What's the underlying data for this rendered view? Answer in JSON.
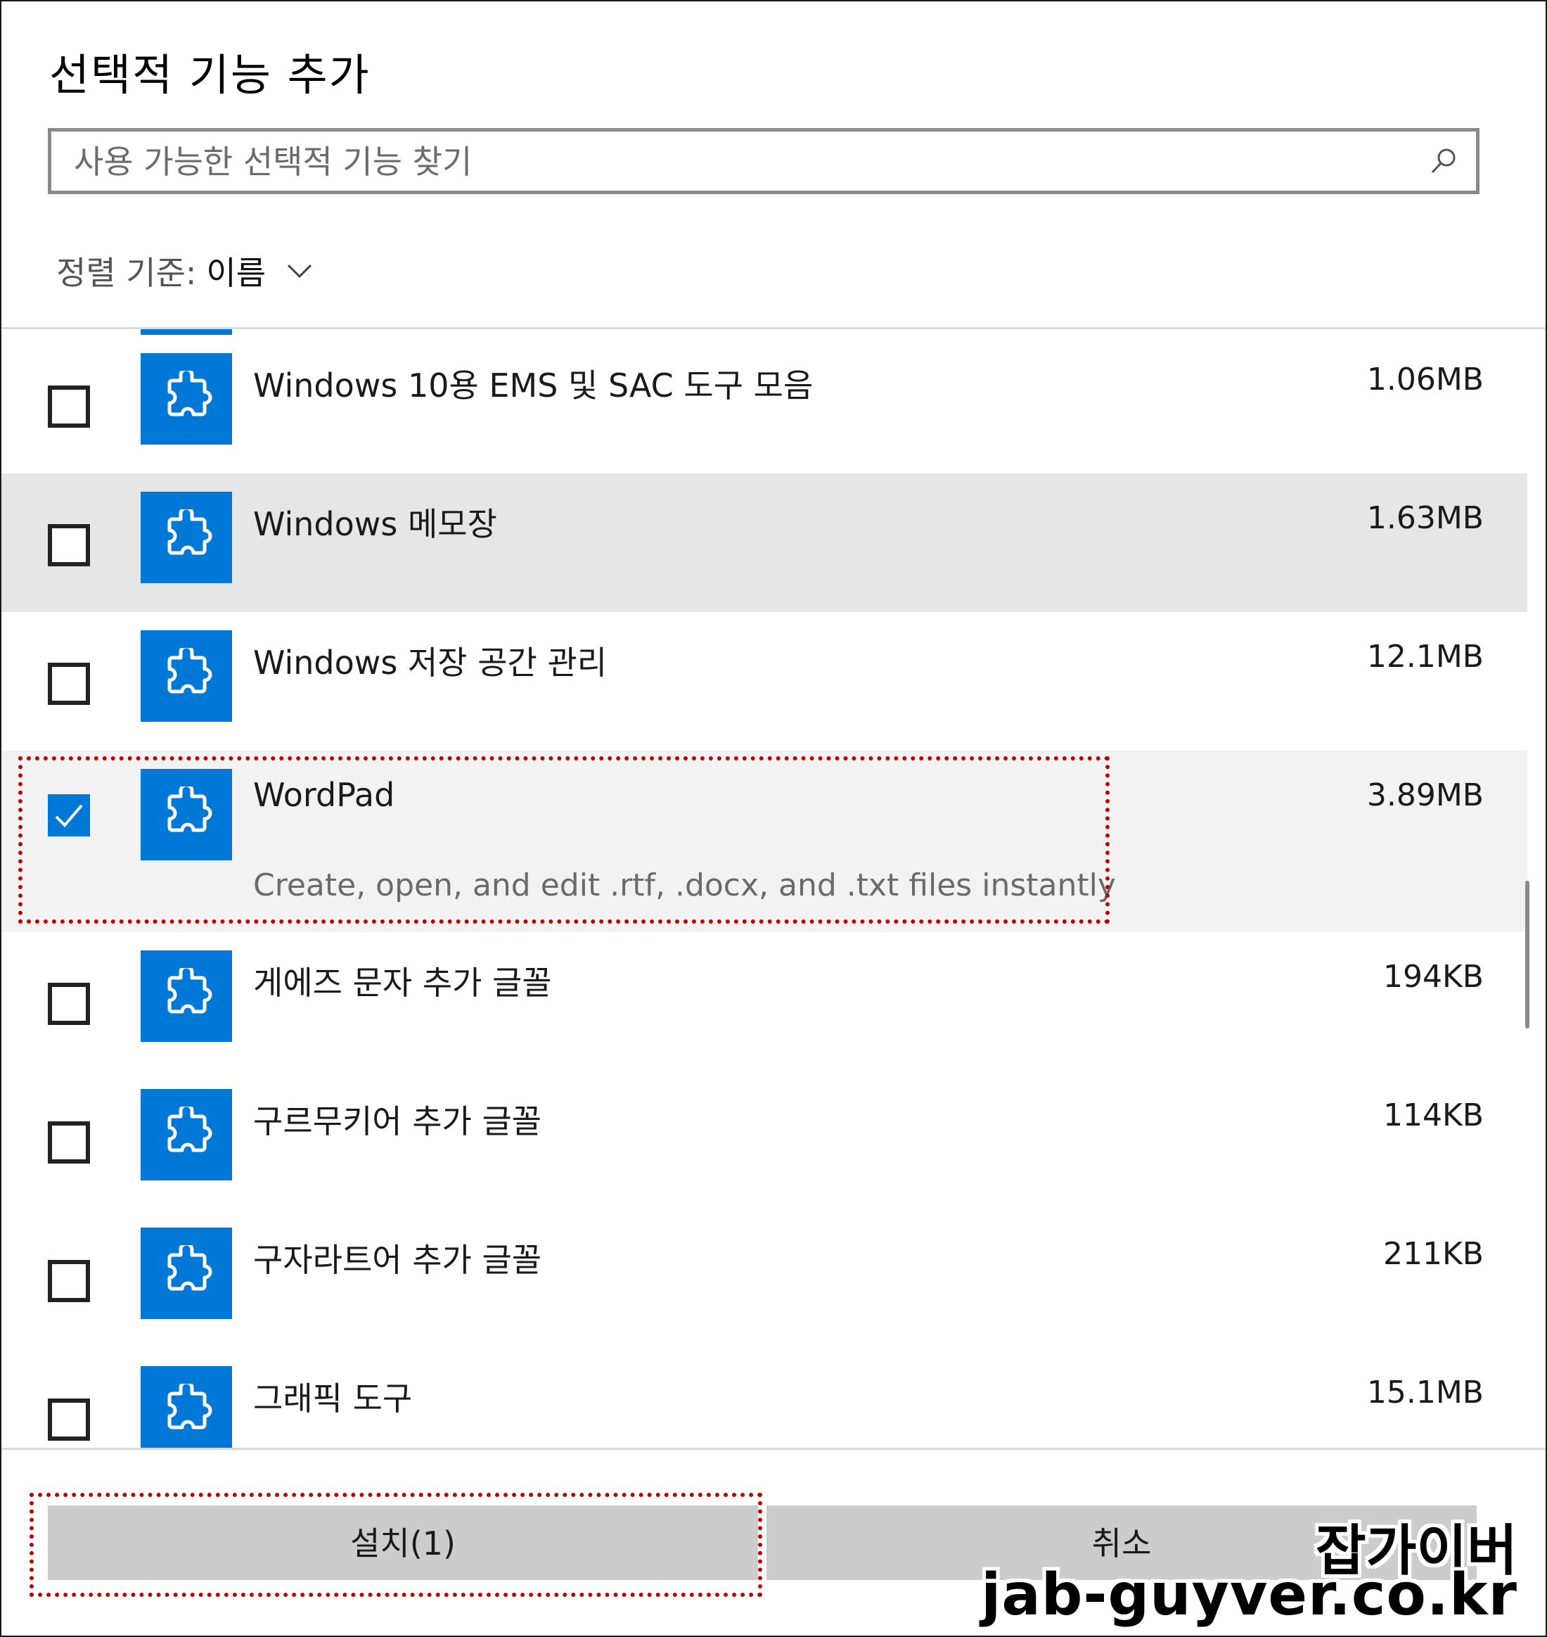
{
  "title": "선택적 기능 추가",
  "search": {
    "placeholder": "사용 가능한 선택적 기능 찾기"
  },
  "sort": {
    "label": "정렬 기준:",
    "value": "이름"
  },
  "features": [
    {
      "name": "Windows 10용 EMS 및 SAC 도구 모음",
      "size": "1.06MB",
      "checked": false
    },
    {
      "name": "Windows 메모장",
      "size": "1.63MB",
      "checked": false
    },
    {
      "name": "Windows 저장 공간 관리",
      "size": "12.1MB",
      "checked": false
    },
    {
      "name": "WordPad",
      "size": "3.89MB",
      "checked": true,
      "description": "Create, open, and edit .rtf, .docx, and .txt files instantly"
    },
    {
      "name": "게에즈 문자 추가 글꼴",
      "size": "194KB",
      "checked": false
    },
    {
      "name": "구르무키어 추가 글꼴",
      "size": "114KB",
      "checked": false
    },
    {
      "name": "구자라트어 추가 글꼴",
      "size": "211KB",
      "checked": false
    },
    {
      "name": "그래픽 도구",
      "size": "15.1MB",
      "checked": false
    }
  ],
  "buttons": {
    "install": "설치(1)",
    "cancel": "취소"
  },
  "watermark": {
    "line1": "잡가이버",
    "line2": "jab-guyver.co.kr"
  },
  "colors": {
    "accent": "#0078d7",
    "highlight_border": "#c00000",
    "button_bg": "#cccccc",
    "hover_row": "#e6e6e6",
    "selected_row": "#f2f2f2"
  }
}
